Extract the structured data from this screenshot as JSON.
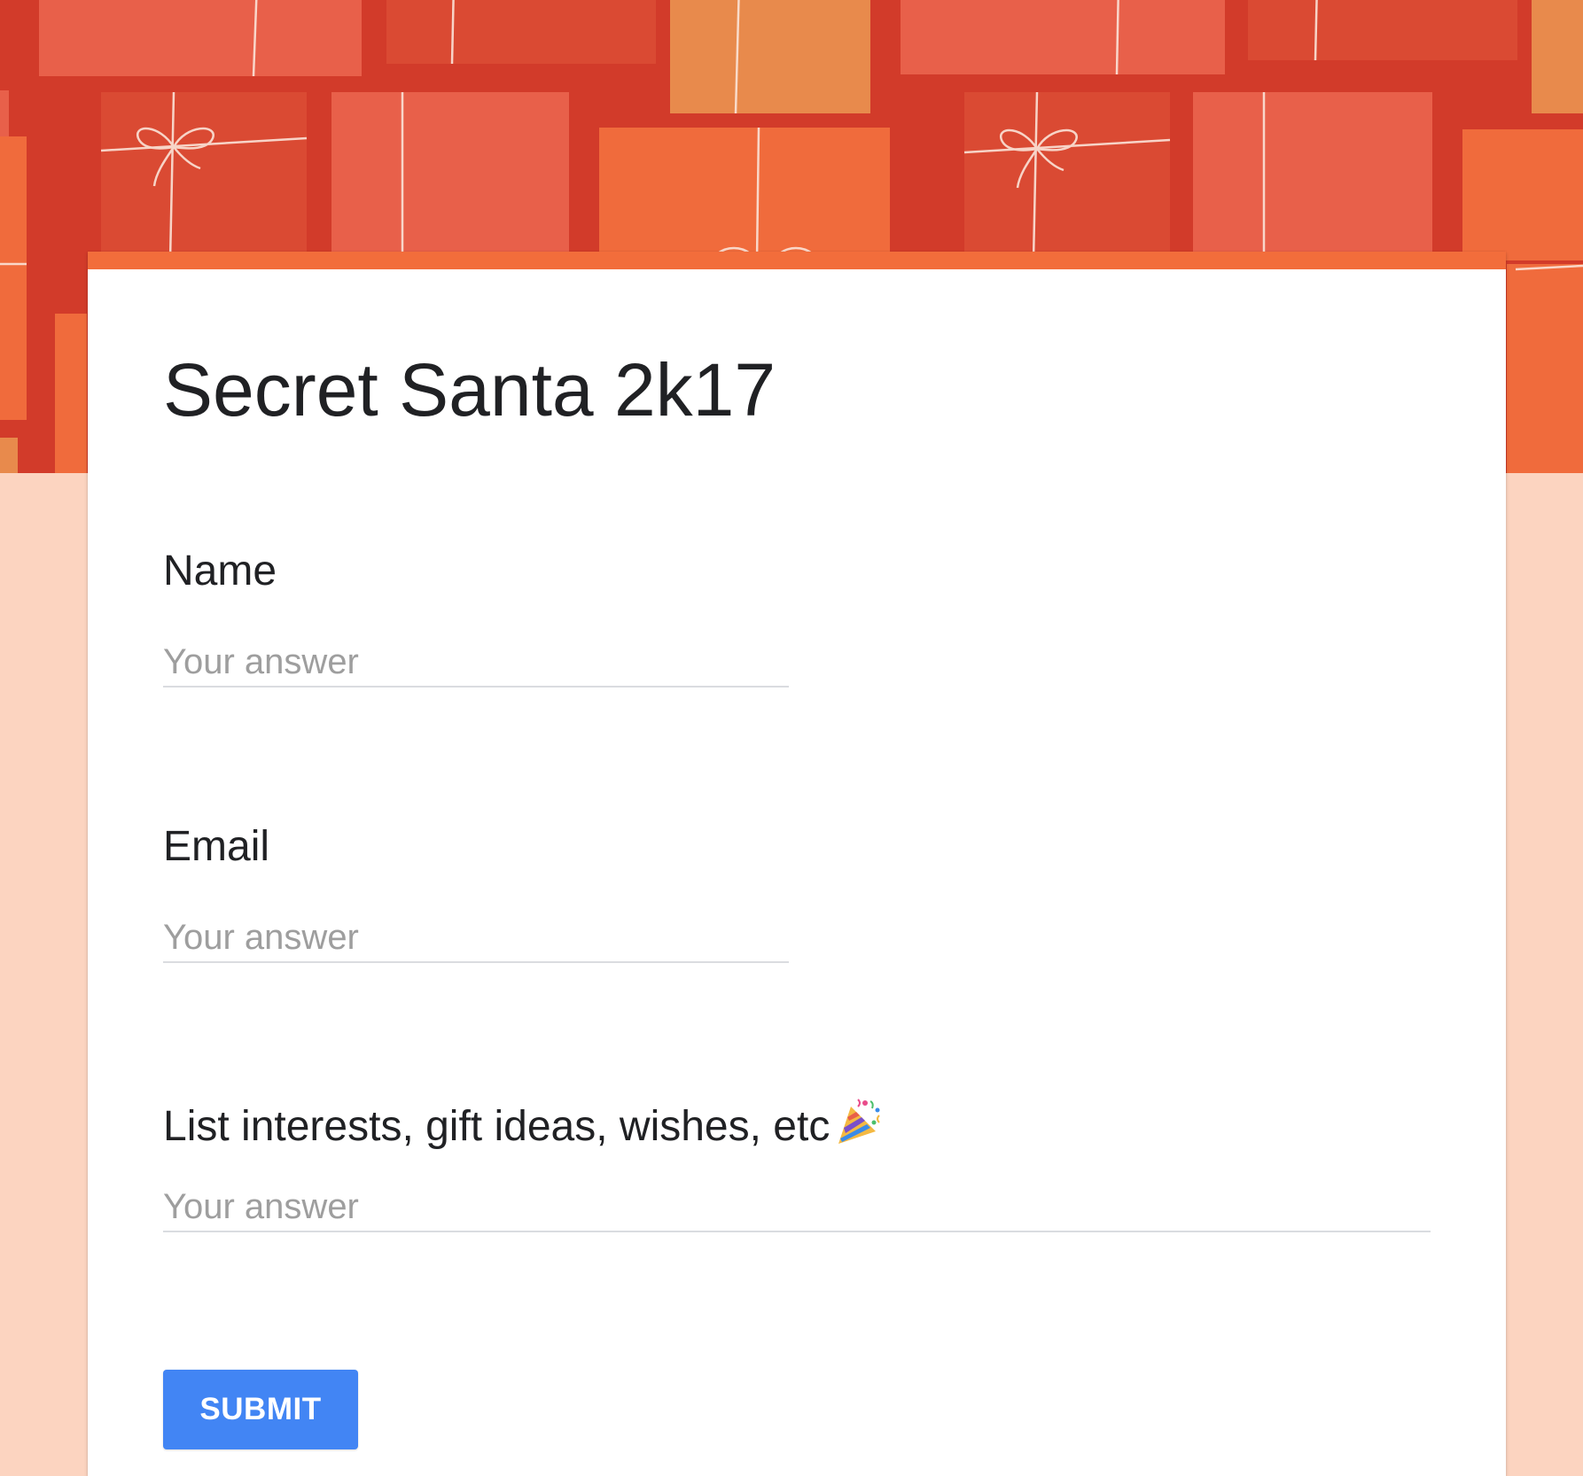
{
  "form": {
    "title": "Secret Santa 2k17",
    "questions": [
      {
        "label": "Name",
        "placeholder": "Your answer"
      },
      {
        "label": "Email",
        "placeholder": "Your answer"
      },
      {
        "label": "List interests, gift ideas, wishes, etc",
        "placeholder": "Your answer",
        "icon": "party-popper-icon"
      }
    ],
    "submit_label": "SUBMIT"
  },
  "colors": {
    "background": "#fcd4c0",
    "banner": "#d23b2a",
    "card_accent": "#f26d3b",
    "submit_button": "#4285f4"
  },
  "header": {
    "image": "gift-boxes-pattern"
  }
}
